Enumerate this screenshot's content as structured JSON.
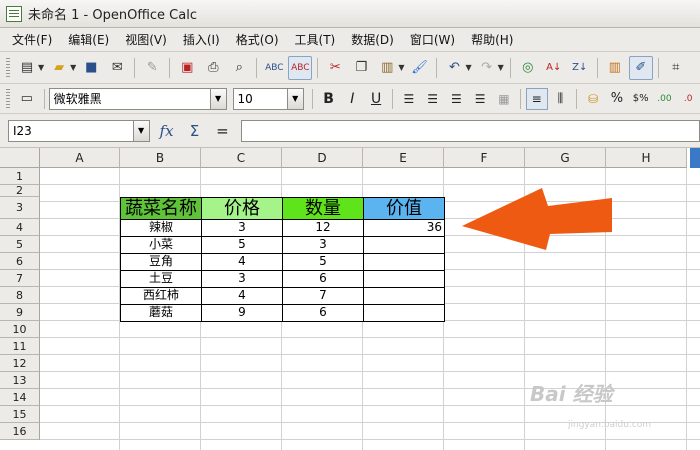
{
  "window": {
    "title": "未命名 1 - OpenOffice Calc"
  },
  "menu": [
    "文件(F)",
    "编辑(E)",
    "视图(V)",
    "插入(I)",
    "格式(O)",
    "工具(T)",
    "数据(D)",
    "窗口(W)",
    "帮助(H)"
  ],
  "format": {
    "font_name": "微软雅黑",
    "font_size": "10"
  },
  "formula": {
    "name_box": "I23",
    "function_icon": "fx",
    "sum_icon": "Σ",
    "equals": "=",
    "input": ""
  },
  "columns": [
    "A",
    "B",
    "C",
    "D",
    "E",
    "F",
    "G",
    "H"
  ],
  "rows": [
    "1",
    "2",
    "3",
    "4",
    "5",
    "6",
    "7",
    "8",
    "9",
    "10",
    "11",
    "12",
    "13",
    "14",
    "15",
    "16"
  ],
  "table": {
    "headers": [
      "蔬菜名称",
      "价格",
      "数量",
      "价值"
    ],
    "header_colors": [
      "#5fc43a",
      "#a4f48a",
      "#5fe31a",
      "#5bb3f0"
    ],
    "rows": [
      [
        "辣椒",
        "3",
        "12",
        "36"
      ],
      [
        "小菜",
        "5",
        "3",
        ""
      ],
      [
        "豆角",
        "4",
        "5",
        ""
      ],
      [
        "土豆",
        "3",
        "6",
        ""
      ],
      [
        "西红柿",
        "4",
        "7",
        ""
      ],
      [
        "蘑菇",
        "9",
        "6",
        ""
      ]
    ]
  },
  "annotation": {
    "arrow_color": "#ef5a12"
  },
  "watermark": {
    "text": "Bai 经验",
    "sub": "jingyan.baidu.com"
  }
}
